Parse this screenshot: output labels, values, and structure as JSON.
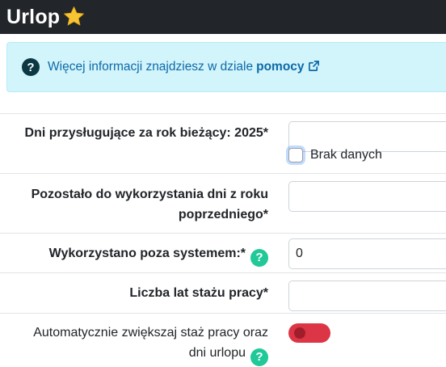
{
  "header": {
    "title": "Urlop",
    "star_icon": "star-icon"
  },
  "info_alert": {
    "icon": "question-circle-icon",
    "text": "Więcej informacji znajdziesz w dziale",
    "link_label": "pomocy",
    "link_icon": "external-link-icon"
  },
  "form": {
    "days_current_year": {
      "label": "Dni przysługujące za rok bieżący: 2025*",
      "value": "",
      "no_data_label": "Brak danych",
      "no_data_checked": false
    },
    "days_previous_year": {
      "label_line1": "Pozostało do wykorzystania dni z roku",
      "label_line2": "poprzedniego*",
      "value": ""
    },
    "used_outside_system": {
      "label": "Wykorzystano poza systemem:*",
      "value": "0",
      "help_icon": "help-icon"
    },
    "years_of_service": {
      "label": "Liczba lat stażu pracy*",
      "value": ""
    },
    "auto_increase": {
      "label_line1": "Automatycznie zwiększaj staż pracy oraz",
      "label_line2": "dni urlopu",
      "enabled": false,
      "help_icon": "help-icon"
    }
  },
  "colors": {
    "header_bg": "#22262b",
    "alert_bg": "#d2f4fb",
    "link": "#0d6aa8",
    "help_green": "#20c997",
    "toggle_red": "#dc3545"
  }
}
